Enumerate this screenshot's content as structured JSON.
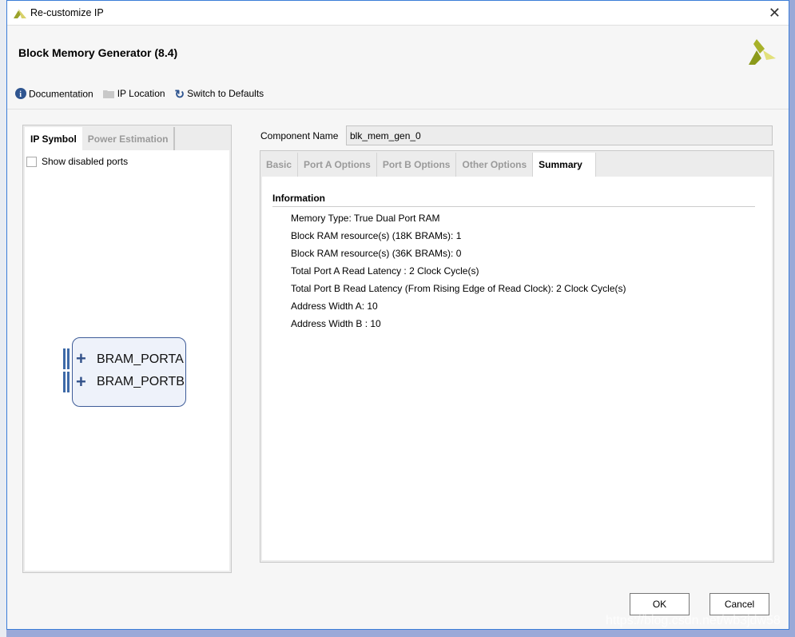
{
  "window": {
    "title": "Re-customize IP"
  },
  "header": {
    "title": "Block Memory Generator (8.4)"
  },
  "toolbar": {
    "documentation": "Documentation",
    "ip_location": "IP Location",
    "switch_defaults": "Switch to Defaults"
  },
  "left_panel": {
    "tabs": [
      "IP Symbol",
      "Power Estimation"
    ],
    "show_disabled_ports": "Show disabled ports",
    "show_disabled_checked": false,
    "ports": [
      "BRAM_PORTA",
      "BRAM_PORTB"
    ]
  },
  "component": {
    "label": "Component Name",
    "value": "blk_mem_gen_0"
  },
  "right_panel": {
    "tabs": [
      "Basic",
      "Port A Options",
      "Port B Options",
      "Other Options",
      "Summary"
    ],
    "active_tab": "Summary",
    "section": "Information",
    "lines": [
      "Memory Type: True Dual Port RAM",
      "Block RAM resource(s) (18K BRAMs): 1",
      "Block RAM resource(s) (36K BRAMs): 0",
      "Total Port A Read Latency : 2 Clock Cycle(s)",
      "Total Port B Read Latency (From Rising Edge of Read Clock): 2 Clock Cycle(s)",
      "Address Width A: 10",
      "Address Width B : 10"
    ]
  },
  "buttons": {
    "ok": "OK",
    "cancel": "Cancel"
  },
  "watermark": "https://blog.csdn.net/wb3jdw58"
}
